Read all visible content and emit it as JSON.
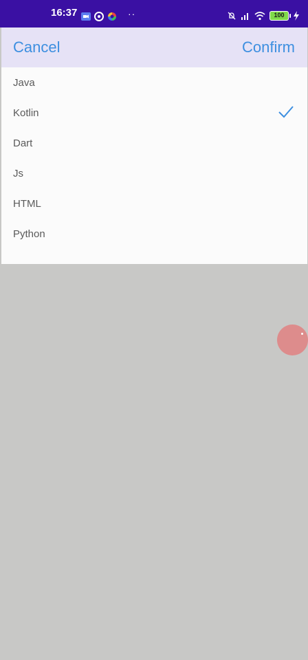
{
  "status_bar": {
    "time": "16:37",
    "battery_level": "100",
    "icons": [
      "video-camera-icon",
      "aperture-icon",
      "color-wheel-icon",
      "mute-bell-icon",
      "signal-icon",
      "wifi-icon",
      "battery-icon",
      "charging-icon"
    ],
    "more_dots": "··"
  },
  "header": {
    "cancel_label": "Cancel",
    "confirm_label": "Confirm",
    "accent_color": "#3d8fe0"
  },
  "list": {
    "items": [
      {
        "label": "Java"
      },
      {
        "label": "Kotlin",
        "selected": true
      },
      {
        "label": "Dart"
      },
      {
        "label": "Js"
      },
      {
        "label": "HTML"
      },
      {
        "label": "Python"
      }
    ]
  }
}
